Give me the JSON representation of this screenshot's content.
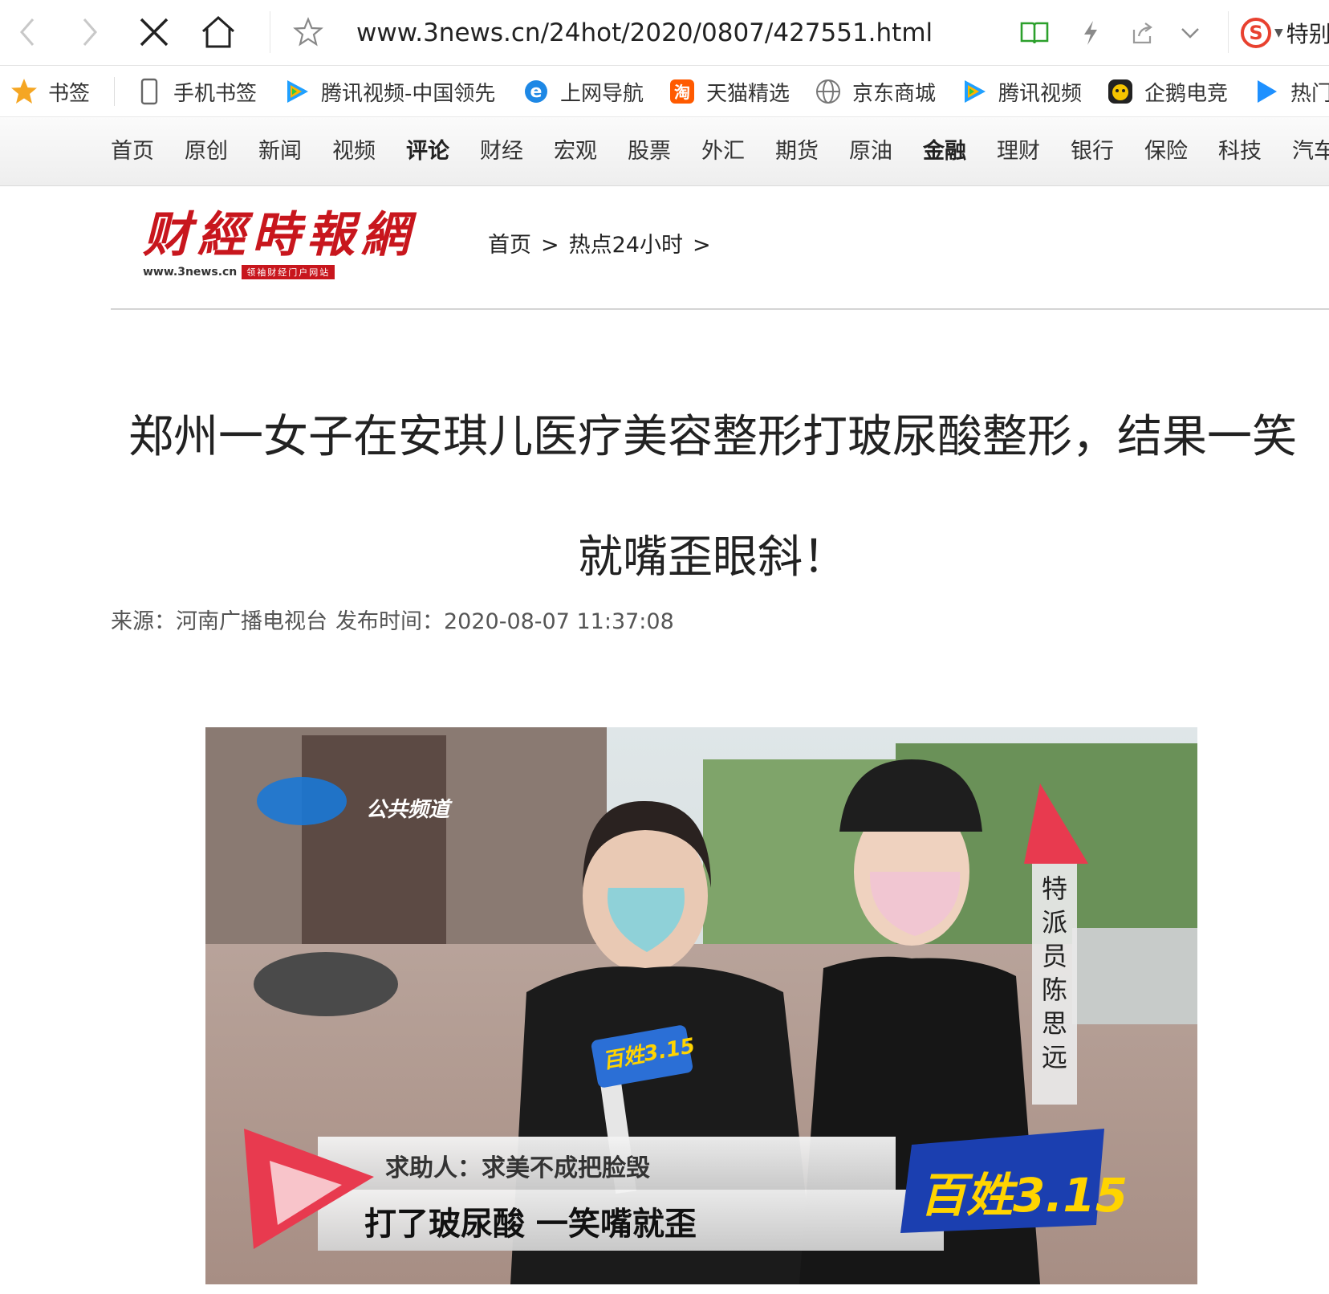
{
  "browser": {
    "url": "www.3news.cn/24hot/2020/0807/427551.html",
    "search_engine_text": "特别"
  },
  "bookmarks": [
    {
      "label": "书签",
      "icon": "star-icon"
    },
    {
      "label": "手机书签",
      "icon": "phone-icon"
    },
    {
      "label": "腾讯视频-中国领先",
      "icon": "tencent-video-icon"
    },
    {
      "label": "上网导航",
      "icon": "ie-icon"
    },
    {
      "label": "天猫精选",
      "icon": "taobao-icon"
    },
    {
      "label": "京东商城",
      "icon": "globe-icon"
    },
    {
      "label": "腾讯视频",
      "icon": "tencent-video-icon"
    },
    {
      "label": "企鹅电竞",
      "icon": "penguin-icon"
    },
    {
      "label": "热门",
      "icon": "play-icon"
    }
  ],
  "site_nav": [
    {
      "label": "首页",
      "bold": false
    },
    {
      "label": "原创",
      "bold": false
    },
    {
      "label": "新闻",
      "bold": false
    },
    {
      "label": "视频",
      "bold": false
    },
    {
      "label": "评论",
      "bold": true
    },
    {
      "label": "财经",
      "bold": false
    },
    {
      "label": "宏观",
      "bold": false
    },
    {
      "label": "股票",
      "bold": false
    },
    {
      "label": "外汇",
      "bold": false
    },
    {
      "label": "期货",
      "bold": false
    },
    {
      "label": "原油",
      "bold": false
    },
    {
      "label": "金融",
      "bold": true
    },
    {
      "label": "理财",
      "bold": false
    },
    {
      "label": "银行",
      "bold": false
    },
    {
      "label": "保险",
      "bold": false
    },
    {
      "label": "科技",
      "bold": false
    },
    {
      "label": "汽车",
      "bold": false
    }
  ],
  "site": {
    "logo_text": "财經時報網",
    "logo_url": "www.3news.cn",
    "logo_tagline": "领袖财经门户网站"
  },
  "breadcrumb": {
    "home": "首页",
    "separator": ">",
    "section": "热点24小时"
  },
  "article": {
    "title": "郑州一女子在安琪儿医疗美容整形打玻尿酸整形，结果一笑就嘴歪眼斜！",
    "source_label": "来源：河南广播电视台",
    "published_label": "发布时间：2020-08-07 11:37:08"
  },
  "video_frame": {
    "channel_logo": "公共频道",
    "caption_line1": "求助人：求美不成把脸毁",
    "caption_line2": "打了玻尿酸 一笑嘴就歪",
    "reporter_label": "特派员 陈思远",
    "program_logo": "百姓3.15",
    "mic_logo": "百姓3.15"
  },
  "colors": {
    "brand_red": "#c8161d",
    "caption_red": "#e83a4f"
  }
}
